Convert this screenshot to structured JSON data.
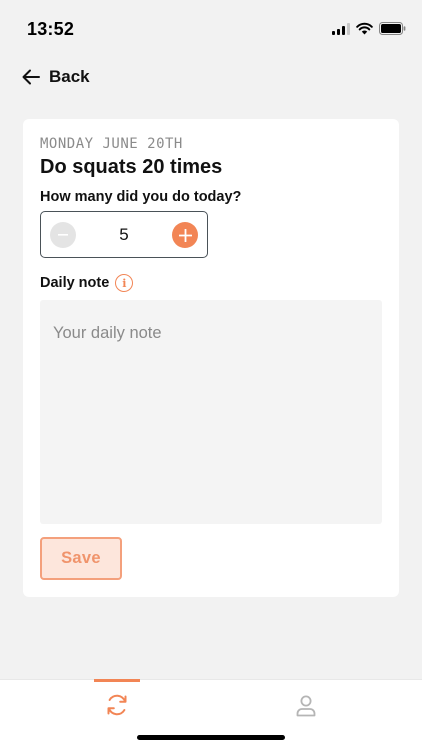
{
  "status_bar": {
    "time": "13:52"
  },
  "nav": {
    "back_label": "Back"
  },
  "card": {
    "date": "MONDAY JUNE 20TH",
    "title": "Do squats 20 times",
    "question": "How many did you do today?",
    "count": "5",
    "note_label": "Daily note",
    "note_placeholder": "Your daily note",
    "note_value": "",
    "save_label": "Save"
  },
  "tabs": [
    {
      "icon": "refresh-icon",
      "active": true
    },
    {
      "icon": "user-icon",
      "active": false
    }
  ],
  "colors": {
    "accent": "#f28555",
    "background": "#f2f2f2",
    "card": "#ffffff"
  }
}
